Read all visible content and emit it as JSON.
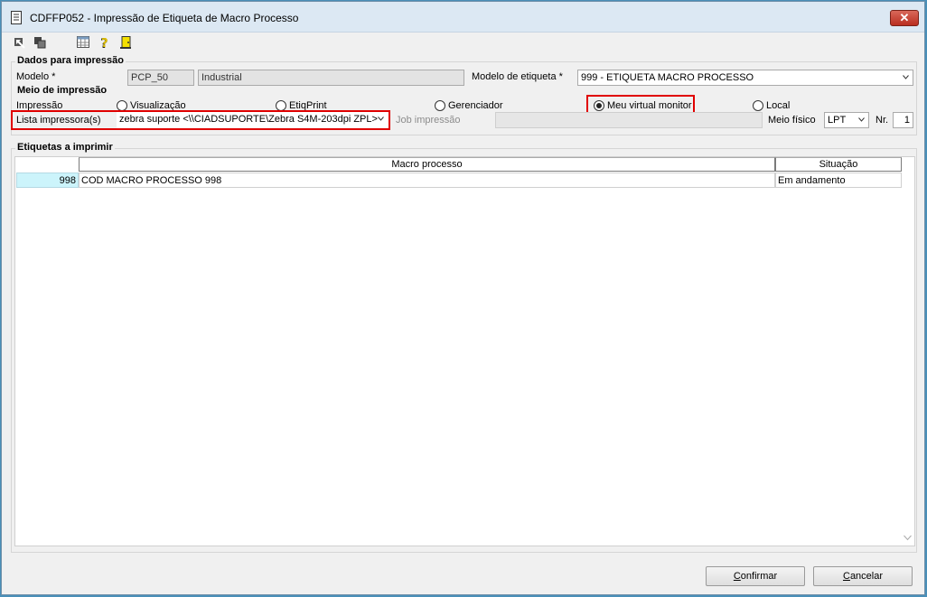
{
  "window": {
    "title": "CDFFP052 - Impressão de Etiqueta de Macro Processo",
    "close_label": "✕"
  },
  "toolbar": {
    "icons": [
      "arrow-icon",
      "copy-icon",
      "grid-icon",
      "help-icon",
      "exit-door-icon"
    ]
  },
  "dados": {
    "section_title": "Dados para impressão",
    "modelo_label": "Modelo *",
    "modelo_code": "PCP_50",
    "modelo_desc": "Industrial",
    "modelo_etiqueta_label": "Modelo de etiqueta *",
    "modelo_etiqueta_value": "999 - ETIQUETA MACRO PROCESSO"
  },
  "meio": {
    "section_title": "Meio de impressão",
    "impressao_label": "Impressão",
    "radios": [
      {
        "label": "Visualização",
        "selected": false
      },
      {
        "label": "EtiqPrint",
        "selected": false
      },
      {
        "label": "Gerenciador",
        "selected": false
      },
      {
        "label": "Meu virtual monitor",
        "selected": true
      },
      {
        "label": "Local",
        "selected": false
      }
    ],
    "lista_label": "Lista impressora(s)",
    "lista_value": "zebra suporte <\\\\CIADSUPORTE\\Zebra S4M-203dpi ZPL>",
    "job_label": "Job impressão",
    "job_value": "",
    "meio_fisico_label": "Meio físico",
    "meio_fisico_value": "LPT",
    "nr_label": "Nr.",
    "nr_value": "1"
  },
  "etiquetas": {
    "section_title": "Etiquetas a imprimir",
    "columns": [
      "Macro processo",
      "Situação"
    ],
    "rows": [
      {
        "code": "998",
        "macro": "COD MACRO PROCESSO 998",
        "situacao": "Em andamento"
      }
    ]
  },
  "buttons": {
    "confirmar_mnemonic": "C",
    "confirmar_rest": "onfirmar",
    "cancelar_mnemonic": "C",
    "cancelar_rest": "ancelar"
  },
  "colors": {
    "highlight": "#e00000",
    "code_cell_bg": "#ccf4fb"
  }
}
